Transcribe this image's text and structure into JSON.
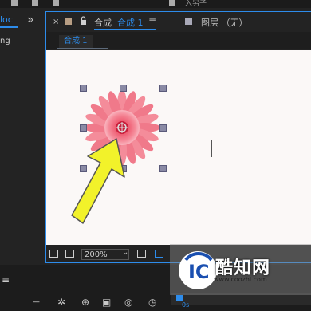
{
  "top": {
    "right_label": "入另子"
  },
  "left": {
    "tab_label": "loc",
    "chevrons": "»",
    "item_label": "ng"
  },
  "tabs": {
    "close": "×",
    "comp_label": "合成",
    "comp_name": "合成 1",
    "menu": "≡",
    "layer_label": "图层 （无）"
  },
  "breadcrumb": {
    "label": "合成 1"
  },
  "viewer_footer": {
    "zoom": "200%",
    "zoom_caret": "⌄"
  },
  "bottom": {
    "hamburger": "≡",
    "time_label": "0s"
  },
  "watermark": {
    "brand": "酷知网",
    "url": "www.coozhi.com"
  },
  "colors": {
    "accent": "#2d8ceb",
    "flower": "#f07c8c",
    "arrow": "#f2f22a",
    "viewer_bg": "#fbf8f7"
  }
}
